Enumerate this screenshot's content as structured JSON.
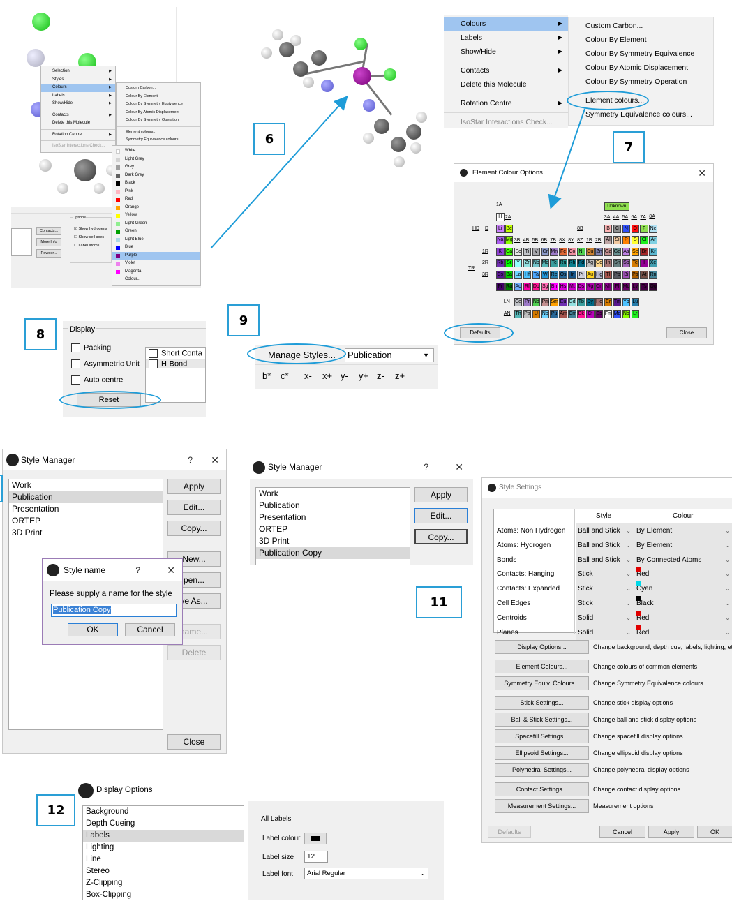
{
  "steps": {
    "s6": "6",
    "s7": "7",
    "s8": "8",
    "s9": "9",
    "s11": "11",
    "s12": "12"
  },
  "small_menu": {
    "items": [
      "Selection",
      "Styles",
      "Colours",
      "Labels",
      "Show/Hide",
      "Contacts",
      "Delete this Molecule",
      "Rotation Centre",
      "IsoStar Interactions Check..."
    ],
    "sub": [
      "Custom Carbon...",
      "Colour By Element",
      "Colour By Symmetry Equivalence",
      "Colour By Atomic Displacement",
      "Colour By Symmetry Operation",
      "Element colours...",
      "Symmetry Equivalence colours..."
    ],
    "colours": [
      {
        "name": "White",
        "hex": "#ffffff"
      },
      {
        "name": "Light Grey",
        "hex": "#d3d3d3"
      },
      {
        "name": "Grey",
        "hex": "#a0a0a0"
      },
      {
        "name": "Dark Grey",
        "hex": "#606060"
      },
      {
        "name": "Black",
        "hex": "#000000"
      },
      {
        "name": "Pink",
        "hex": "#ffb6c1"
      },
      {
        "name": "Red",
        "hex": "#ff0000"
      },
      {
        "name": "Orange",
        "hex": "#ffa500"
      },
      {
        "name": "Yellow",
        "hex": "#ffff00"
      },
      {
        "name": "Light Green",
        "hex": "#90ee90"
      },
      {
        "name": "Green",
        "hex": "#00a000"
      },
      {
        "name": "Light Blue",
        "hex": "#add8e6"
      },
      {
        "name": "Blue",
        "hex": "#0000ff"
      },
      {
        "name": "Purple",
        "hex": "#800080"
      },
      {
        "name": "Violet",
        "hex": "#ee82ee"
      },
      {
        "name": "Magenta",
        "hex": "#ff00ff"
      }
    ],
    "colour_more": "Colour...",
    "options_title": "Options",
    "opt_show_h": "Show hydrogens",
    "opt_cell": "Show cell axes",
    "opt_label": "Label atoms",
    "btn_contacts": "Contacts...",
    "btn_more": "More Info",
    "btn_powder": "Powder..."
  },
  "big_menu": {
    "items": [
      "Colours",
      "Labels",
      "Show/Hide",
      "Contacts",
      "Delete this Molecule",
      "Rotation Centre",
      "IsoStar Interactions Check..."
    ],
    "sub": [
      "Custom Carbon...",
      "Colour By Element",
      "Colour By Symmetry Equivalence",
      "Colour By Atomic Displacement",
      "Colour By Symmetry Operation",
      "Element colours...",
      "Symmetry Equivalence colours..."
    ]
  },
  "element_dialog": {
    "title": "Element Colour Options",
    "defaults": "Defaults",
    "close": "Close",
    "unknown": "Unknown",
    "groups": {
      "g1a": "1A",
      "g8a": "8A",
      "g3a": "3A",
      "g4a": "4A",
      "g5a": "5A",
      "g6a": "6A",
      "g7a": "7A",
      "g2a": "2A",
      "g8b": "8B",
      "g3b": "3B",
      "g4b": "4B",
      "g5b": "5B",
      "g6b": "6B",
      "g7b": "7B",
      "g8x": "8X",
      "g8y": "8Y",
      "g8z": "8Z",
      "g1b": "1B",
      "g2b": "2B"
    },
    "rows": {
      "hd": "HD",
      "d": "D",
      "r1": "1R",
      "r2": "2R",
      "r3": "3R",
      "tr": "TR",
      "ln": "LN",
      "an": "AN"
    }
  },
  "display": {
    "title": "Display",
    "packing": "Packing",
    "asym": "Asymmetric Unit",
    "auto": "Auto centre",
    "reset": "Reset",
    "short": "Short Conta",
    "hbond": "H-Bond"
  },
  "toolbar": {
    "manage": "Manage Styles...",
    "style": "Publication",
    "axes": [
      "b*",
      "c*",
      "x-",
      "x+",
      "y-",
      "y+",
      "z-",
      "z+"
    ]
  },
  "style_manager": {
    "title": "Style Manager",
    "items": [
      "Work",
      "Publication",
      "Presentation",
      "ORTEP",
      "3D Print"
    ],
    "apply": "Apply",
    "edit": "Edit...",
    "copy": "Copy...",
    "new": "New...",
    "open": "pen...",
    "saveas": "ve As...",
    "rename": "name...",
    "delete": "Delete",
    "close": "Close",
    "help": "?",
    "x": "✕"
  },
  "style_name": {
    "title": "Style name",
    "prompt": "Please supply a name for the style",
    "value": "Publication Copy",
    "ok": "OK",
    "cancel": "Cancel",
    "help": "?",
    "x": "✕"
  },
  "style_manager2": {
    "title": "Style Manager",
    "items": [
      "Work",
      "Publication",
      "Presentation",
      "ORTEP",
      "3D Print",
      "Publication Copy"
    ],
    "apply": "Apply",
    "edit": "Edit...",
    "copy": "Copy..."
  },
  "style_settings": {
    "title": "Style Settings",
    "h_style": "Style",
    "h_colour": "Colour",
    "rows": [
      {
        "label": "Atoms: Non Hydrogen",
        "style": "Ball and Stick",
        "colour": "By Element",
        "swatch": ""
      },
      {
        "label": "Atoms: Hydrogen",
        "style": "Ball and Stick",
        "colour": "By Element",
        "swatch": ""
      },
      {
        "label": "Bonds",
        "style": "Ball and Stick",
        "colour": "By Connected Atoms",
        "swatch": ""
      },
      {
        "label": "Contacts: Hanging",
        "style": "Stick",
        "colour": "Red",
        "swatch": "#e00000"
      },
      {
        "label": "Contacts: Expanded",
        "style": "Stick",
        "colour": "Cyan",
        "swatch": "#00d8e8"
      },
      {
        "label": "Cell Edges",
        "style": "Stick",
        "colour": "Black",
        "swatch": "#000000"
      },
      {
        "label": "Centroids",
        "style": "Solid",
        "colour": "Red",
        "swatch": "#e00000"
      },
      {
        "label": "Planes",
        "style": "Solid",
        "colour": "Red",
        "swatch": "#e00000"
      }
    ],
    "buttons": [
      {
        "b": "Display Options...",
        "d": "Change background, depth cue, labels, lighting, etc"
      },
      {
        "b": "Element Colours...",
        "d": "Change colours of common elements"
      },
      {
        "b": "Symmetry Equiv. Colours...",
        "d": "Change Symmetry Equivalence colours"
      },
      {
        "b": "Stick Settings...",
        "d": "Change stick display options"
      },
      {
        "b": "Ball & Stick Settings...",
        "d": "Change ball and stick display options"
      },
      {
        "b": "Spacefill Settings...",
        "d": "Change spacefill display options"
      },
      {
        "b": "Ellipsoid Settings...",
        "d": "Change ellipsoid display options"
      },
      {
        "b": "Polyhedral Settings...",
        "d": "Change polyhedral display options"
      },
      {
        "b": "Contact Settings...",
        "d": "Change contact display options"
      },
      {
        "b": "Measurement Settings...",
        "d": "Measurement options"
      }
    ],
    "defaults": "Defaults",
    "cancel": "Cancel",
    "apply": "Apply",
    "ok": "OK"
  },
  "display_options": {
    "title": "Display Options",
    "items": [
      "Background",
      "Depth Cueing",
      "Labels",
      "Lighting",
      "Line",
      "Stereo",
      "Z-Clipping",
      "Box-Clipping"
    ],
    "group": "All Labels",
    "label_colour": "Label colour",
    "label_size": "Label size",
    "size_value": "12",
    "label_font": "Label font",
    "font_value": "Arial Regular"
  }
}
